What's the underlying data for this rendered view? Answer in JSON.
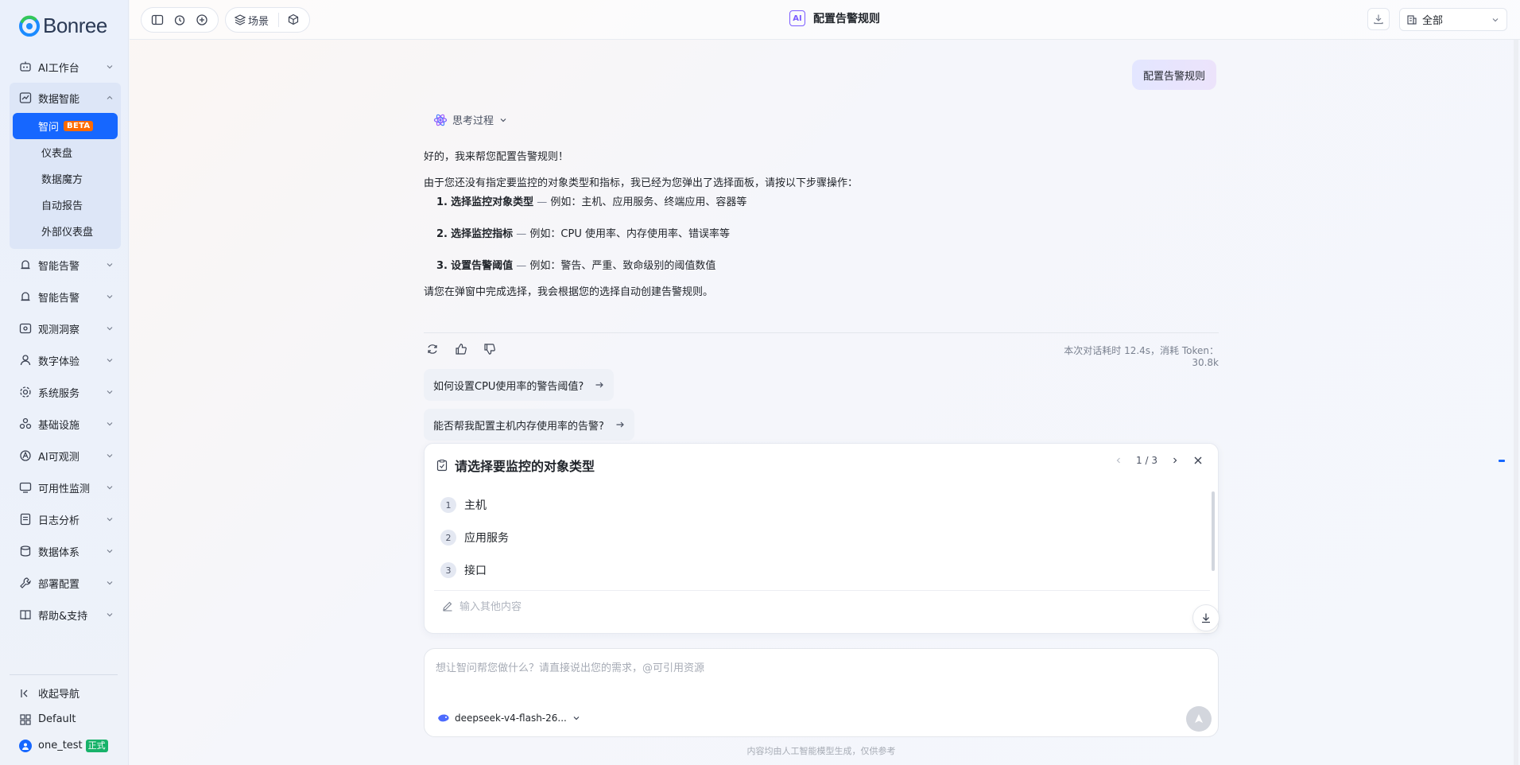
{
  "brand": {
    "name": "Bonree"
  },
  "sidebar": {
    "items": [
      {
        "label": "AI工作台",
        "icon": "robot-icon"
      },
      {
        "label": "数据智能",
        "icon": "chart-icon",
        "open": true,
        "children": [
          {
            "label": "智问",
            "badge": "BETA",
            "active": true
          },
          {
            "label": "仪表盘"
          },
          {
            "label": "数据魔方"
          },
          {
            "label": "自动报告"
          },
          {
            "label": "外部仪表盘"
          }
        ]
      },
      {
        "label": "智能告警",
        "icon": "alarm-icon"
      },
      {
        "label": "智能告警",
        "icon": "alarm-icon"
      },
      {
        "label": "观测洞察",
        "icon": "eye-icon"
      },
      {
        "label": "数字体验",
        "icon": "user-icon"
      },
      {
        "label": "系统服务",
        "icon": "gear-icon"
      },
      {
        "label": "基础设施",
        "icon": "server-icon"
      },
      {
        "label": "AI可观测",
        "icon": "ai-icon"
      },
      {
        "label": "可用性监测",
        "icon": "monitor-icon"
      },
      {
        "label": "日志分析",
        "icon": "log-icon"
      },
      {
        "label": "数据体系",
        "icon": "database-icon"
      },
      {
        "label": "部署配置",
        "icon": "wrench-icon"
      },
      {
        "label": "帮助&支持",
        "icon": "book-icon"
      }
    ],
    "bottom": {
      "collapse": "收起导航",
      "workspace": "Default",
      "user": "one_test",
      "user_tag": "正式"
    }
  },
  "topbar": {
    "scene_label": "场景",
    "title": "配置告警规则",
    "ai_badge": "AI",
    "scope": "全部"
  },
  "chat": {
    "user_message": "配置告警规则",
    "think_label": "思考过程",
    "answer": {
      "greeting": "好的，我来帮您配置告警规则！",
      "intro": "由于您还没有指定要监控的对象类型和指标，我已经为您弹出了选择面板，请按以下步骤操作：",
      "steps": [
        {
          "num": "1.",
          "title": "选择监控对象类型",
          "sep": " — ",
          "desc": "例如：主机、应用服务、终端应用、容器等"
        },
        {
          "num": "2.",
          "title": "选择监控指标",
          "sep": " — ",
          "desc": "例如：CPU 使用率、内存使用率、错误率等"
        },
        {
          "num": "3.",
          "title": "设置告警阈值",
          "sep": " — ",
          "desc": "例如：警告、严重、致命级别的阈值数值"
        }
      ],
      "outro": "请您在弹窗中完成选择，我会根据您的选择自动创建告警规则。"
    },
    "meta": "本次对话耗时 12.4s，消耗 Token：30.8k",
    "suggestions": [
      "如何设置CPU使用率的警告阈值?",
      "能否帮我配置主机内存使用率的告警?"
    ]
  },
  "panel": {
    "title": "请选择要监控的对象类型",
    "pager": "1 / 3",
    "options": [
      {
        "num": "1",
        "label": "主机"
      },
      {
        "num": "2",
        "label": "应用服务"
      },
      {
        "num": "3",
        "label": "接口"
      }
    ],
    "other_placeholder": "输入其他内容"
  },
  "composer": {
    "placeholder": "想让智问帮您做什么？请直接说出您的需求，@可引用资源",
    "model": "deepseek-v4-flash-26..."
  },
  "footer": "内容均由人工智能模型生成，仅供参考",
  "colors": {
    "primary": "#1667ff",
    "beta": "#ff6a00",
    "formal": "#17b26a",
    "ai": "#7b5cff"
  }
}
